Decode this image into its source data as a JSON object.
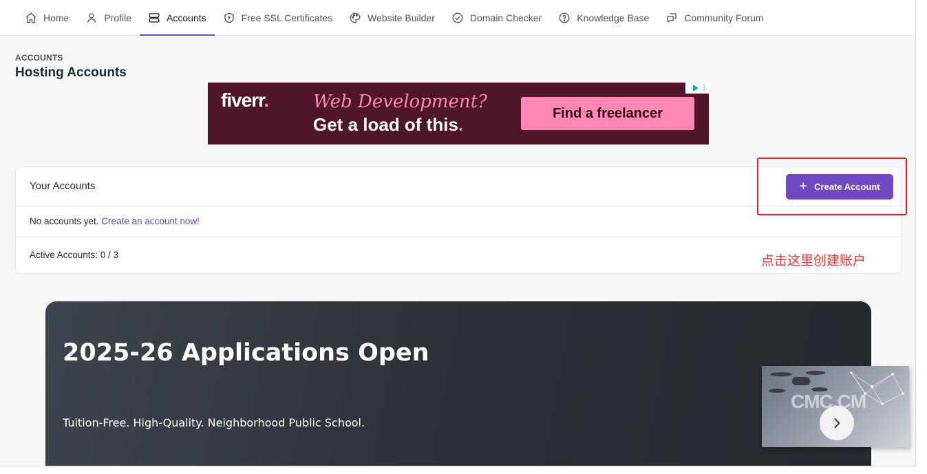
{
  "nav": {
    "items": [
      {
        "label": "Home"
      },
      {
        "label": "Profile"
      },
      {
        "label": "Accounts"
      },
      {
        "label": "Free SSL Certificates"
      },
      {
        "label": "Website Builder"
      },
      {
        "label": "Domain Checker"
      },
      {
        "label": "Knowledge Base"
      },
      {
        "label": "Community Forum"
      }
    ],
    "active_index": 2
  },
  "page": {
    "breadcrumb": "ACCOUNTS",
    "title": "Hosting Accounts"
  },
  "ad": {
    "logo": "fiverr",
    "logo_dot": ".",
    "headline": "Web Development?",
    "subline": "Get a load of this",
    "subline_dot": ".",
    "cta": "Find a freelancer"
  },
  "accounts_card": {
    "title": "Your Accounts",
    "create_button": "Create Account",
    "empty_text": "No accounts yet. ",
    "empty_link": "Create an account now!",
    "active_accounts": "Active Accounts: 0 / 3"
  },
  "annotation": {
    "text": "点击这里创建账户"
  },
  "banner": {
    "title": "2025-26 Applications Open",
    "subtitle": "Tuition-Free. High-Quality. Neighborhood Public School."
  },
  "thumbnail": {
    "watermark": "CMC.CM"
  },
  "colors": {
    "accent": "#7048c4",
    "link": "#6d44c2",
    "annotation": "#ff2a2a",
    "ad_background": "#4e1628",
    "ad_pink": "#ff86b5"
  }
}
